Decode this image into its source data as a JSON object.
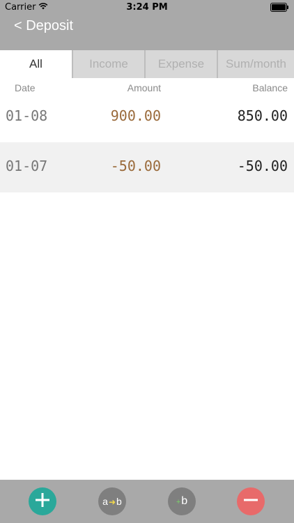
{
  "status": {
    "carrier": "Carrier",
    "time": "3:24 PM"
  },
  "nav": {
    "back_label": "< Deposit"
  },
  "tabs": [
    {
      "label": "All",
      "active": true
    },
    {
      "label": "Income",
      "active": false
    },
    {
      "label": "Expense",
      "active": false
    },
    {
      "label": "Sum/month",
      "active": false
    }
  ],
  "columns": {
    "date": "Date",
    "amount": "Amount",
    "balance": "Balance"
  },
  "rows": [
    {
      "date": "01-08",
      "amount": "900.00",
      "balance": "850.00"
    },
    {
      "date": "01-07",
      "amount": "-50.00",
      "balance": "-50.00"
    }
  ],
  "toolbar": {
    "transfer_a": "a",
    "transfer_b": "b",
    "plus_b_plus": "+",
    "plus_b_b": "b"
  },
  "colors": {
    "header_bg": "#a9a9a9",
    "amount_text": "#9a6a3a",
    "add_button": "#2aa89a",
    "minus_button": "#e86a6a"
  },
  "icons": [
    "wifi-icon",
    "battery-icon",
    "plus-icon",
    "transfer-icon",
    "plus-b-icon",
    "minus-icon"
  ]
}
